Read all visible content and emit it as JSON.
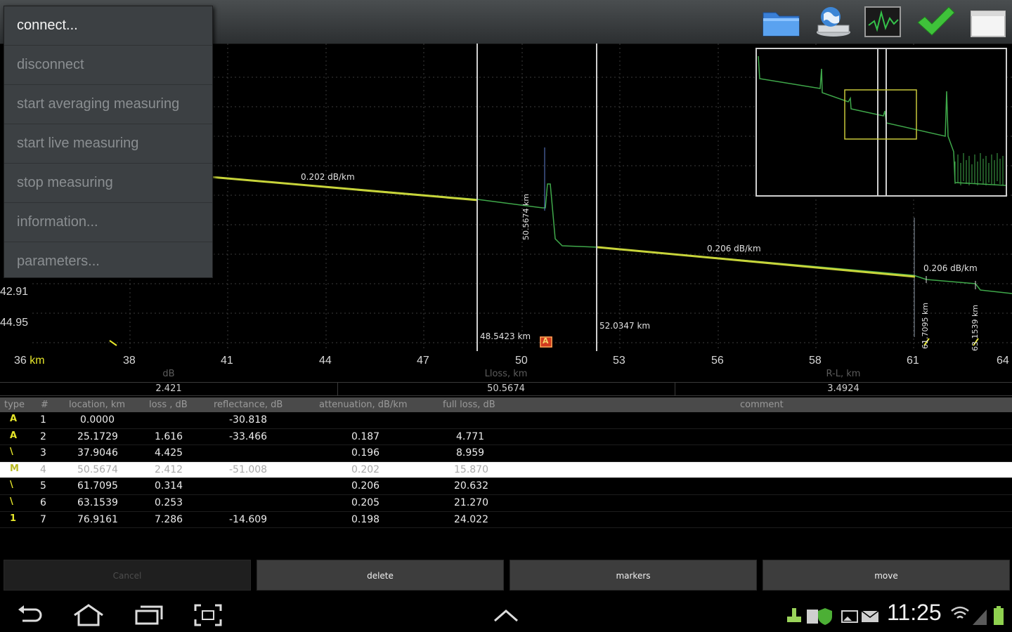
{
  "menu": {
    "items": [
      {
        "label": "connect...",
        "enabled": true
      },
      {
        "label": "disconnect",
        "enabled": false
      },
      {
        "label": "start averaging measuring",
        "enabled": false
      },
      {
        "label": "start live measuring",
        "enabled": false
      },
      {
        "label": "stop measuring",
        "enabled": false
      },
      {
        "label": "information...",
        "enabled": false
      },
      {
        "label": "parameters...",
        "enabled": false
      }
    ]
  },
  "toolbar": {
    "icons": [
      "folder-icon",
      "network-drive-icon",
      "trace-view-icon",
      "checkmark-icon",
      "window-icon"
    ]
  },
  "chart": {
    "x_axis": {
      "unit": "km",
      "ticks": [
        "36",
        "38",
        "41",
        "44",
        "47",
        "50",
        "53",
        "56",
        "58",
        "61",
        "64"
      ]
    },
    "y_labels": [
      "42.91",
      "44.95"
    ],
    "annotations": {
      "att1": "0.202 dB/km",
      "att2": "0.206 dB/km",
      "att3": "0.206 dB/km",
      "cursor_a": "48.5423 km",
      "cursor_b": "52.0347 km",
      "event_label": "50.5674 km",
      "event5_label": "61.7095 km",
      "event6_label": "63.1539 km",
      "marker": "A"
    }
  },
  "summary": {
    "loss_db": {
      "label": "dB",
      "value": "2.421"
    },
    "location": {
      "label": "Lloss, km",
      "value": "50.5674"
    },
    "rl": {
      "label": "R-L, km",
      "value": "3.4924"
    }
  },
  "table": {
    "headers": {
      "type": "type",
      "num": "#",
      "location": "location, km",
      "loss": "loss , dB",
      "reflectance": "reflectance, dB",
      "attenuation": "attenuation, dB/km",
      "full_loss": "full loss, dB",
      "comment": "comment"
    },
    "rows": [
      {
        "type": "A",
        "num": "1",
        "location": "0.0000",
        "loss": "",
        "reflectance": "-30.818",
        "attenuation": "",
        "full_loss": ""
      },
      {
        "type": "A",
        "num": "2",
        "location": "25.1729",
        "loss": "1.616",
        "reflectance": "-33.466",
        "attenuation": "0.187",
        "full_loss": "4.771"
      },
      {
        "type": "\\",
        "num": "3",
        "location": "37.9046",
        "loss": "4.425",
        "reflectance": "",
        "attenuation": "0.196",
        "full_loss": "8.959"
      },
      {
        "type": "M",
        "num": "4",
        "location": "50.5674",
        "loss": "2.412",
        "reflectance": "-51.008",
        "attenuation": "0.202",
        "full_loss": "15.870",
        "selected": true
      },
      {
        "type": "\\",
        "num": "5",
        "location": "61.7095",
        "loss": "0.314",
        "reflectance": "",
        "attenuation": "0.206",
        "full_loss": "20.632"
      },
      {
        "type": "\\",
        "num": "6",
        "location": "63.1539",
        "loss": "0.253",
        "reflectance": "",
        "attenuation": "0.205",
        "full_loss": "21.270"
      },
      {
        "type": "1",
        "num": "7",
        "location": "76.9161",
        "loss": "7.286",
        "reflectance": "-14.609",
        "attenuation": "0.198",
        "full_loss": "24.022"
      }
    ]
  },
  "buttons": {
    "cancel": "Cancel",
    "delete": "delete",
    "markers": "markers",
    "move": "move"
  },
  "statusbar": {
    "time": "11:25"
  },
  "colors": {
    "trace": "#3fa84a",
    "attenuation_line": "#c8d43a",
    "cursor": "#cfcfcf",
    "marker_bg": "#d23a1e"
  }
}
